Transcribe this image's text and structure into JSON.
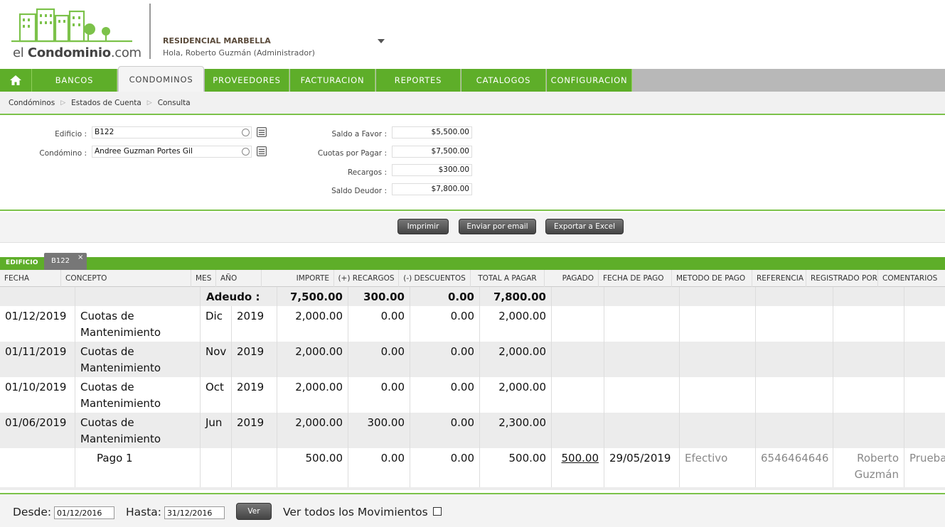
{
  "header": {
    "logo_prefix": "el ",
    "logo_bold": "Condominio",
    "logo_suffix": ".com",
    "condo_name": "RESIDENCIAL MARBELLA",
    "greeting": "Hola, Roberto Guzmán (Administrador)"
  },
  "nav": {
    "items": [
      {
        "label": "BANCOS"
      },
      {
        "label": "CONDOMINOS"
      },
      {
        "label": "PROVEEDORES"
      },
      {
        "label": "FACTURACION"
      },
      {
        "label": "REPORTES"
      },
      {
        "label": "CATALOGOS"
      },
      {
        "label": "CONFIGURACION"
      }
    ],
    "active": "CONDOMINOS"
  },
  "breadcrumb": [
    "Condóminos",
    "Estados de Cuenta",
    "Consulta"
  ],
  "form": {
    "edificio_label": "Edificio :",
    "edificio_value": "B122",
    "condomino_label": "Condómino :",
    "condomino_value": "Andree Guzman Portes Gil",
    "saldo_favor_label": "Saldo a Favor :",
    "saldo_favor_value": "$5,500.00",
    "cuotas_label": "Cuotas por Pagar :",
    "cuotas_value": "$7,500.00",
    "recargos_label": "Recargos :",
    "recargos_value": "$300.00",
    "saldo_deudor_label": "Saldo Deudor :",
    "saldo_deudor_value": "$7,800.00"
  },
  "buttons": {
    "imprimir": "Imprimir",
    "email": "Enviar por email",
    "excel": "Exportar a Excel"
  },
  "tabs": {
    "group_label": "EDIFICIO",
    "tab": "B122",
    "close": "×"
  },
  "table": {
    "headers": [
      "FECHA",
      "CONCEPTO",
      "MES",
      "AÑO",
      "IMPORTE",
      "(+) RECARGOS",
      "(-) DESCUENTOS",
      "TOTAL A PAGAR",
      "PAGADO",
      "FECHA DE PAGO",
      "METODO DE PAGO",
      "REFERENCIA",
      "REGISTRADO POR",
      "COMENTARIOS"
    ],
    "summary": {
      "label": "Adeudo :",
      "importe": "7,500.00",
      "recargos": "300.00",
      "descuentos": "0.00",
      "total": "7,800.00"
    },
    "rows": [
      {
        "fecha": "01/12/2019",
        "concepto": "Cuotas de Mantenimiento",
        "mes": "Dic",
        "anio": "2019",
        "importe": "2,000.00",
        "recargos": "0.00",
        "descuentos": "0.00",
        "total": "2,000.00"
      },
      {
        "fecha": "01/11/2019",
        "concepto": "Cuotas de Mantenimiento",
        "mes": "Nov",
        "anio": "2019",
        "importe": "2,000.00",
        "recargos": "0.00",
        "descuentos": "0.00",
        "total": "2,000.00"
      },
      {
        "fecha": "01/10/2019",
        "concepto": "Cuotas de Mantenimiento",
        "mes": "Oct",
        "anio": "2019",
        "importe": "2,000.00",
        "recargos": "0.00",
        "descuentos": "0.00",
        "total": "2,000.00"
      },
      {
        "fecha": "01/06/2019",
        "concepto": "Cuotas de Mantenimiento",
        "mes": "Jun",
        "anio": "2019",
        "importe": "2,000.00",
        "recargos": "300.00",
        "descuentos": "0.00",
        "total": "2,300.00"
      }
    ],
    "payment": {
      "concepto": "Pago 1",
      "importe": "500.00",
      "recargos": "0.00",
      "descuentos": "0.00",
      "total": "500.00",
      "pagado": "500.00",
      "fecha_pago": "29/05/2019",
      "metodo": "Efectivo",
      "referencia": "6546464646",
      "registrado": "Roberto Guzmán",
      "comentarios": "Prueba"
    }
  },
  "bottom": {
    "desde_label": "Desde:",
    "desde_value": "01/12/2016",
    "hasta_label": "Hasta:",
    "hasta_value": "31/12/2016",
    "ver_button": "Ver",
    "todos_label": "Ver todos los Movimientos"
  },
  "colors": {
    "accent_green": "#5eae29",
    "nav_gray": "#b8b8b8"
  }
}
